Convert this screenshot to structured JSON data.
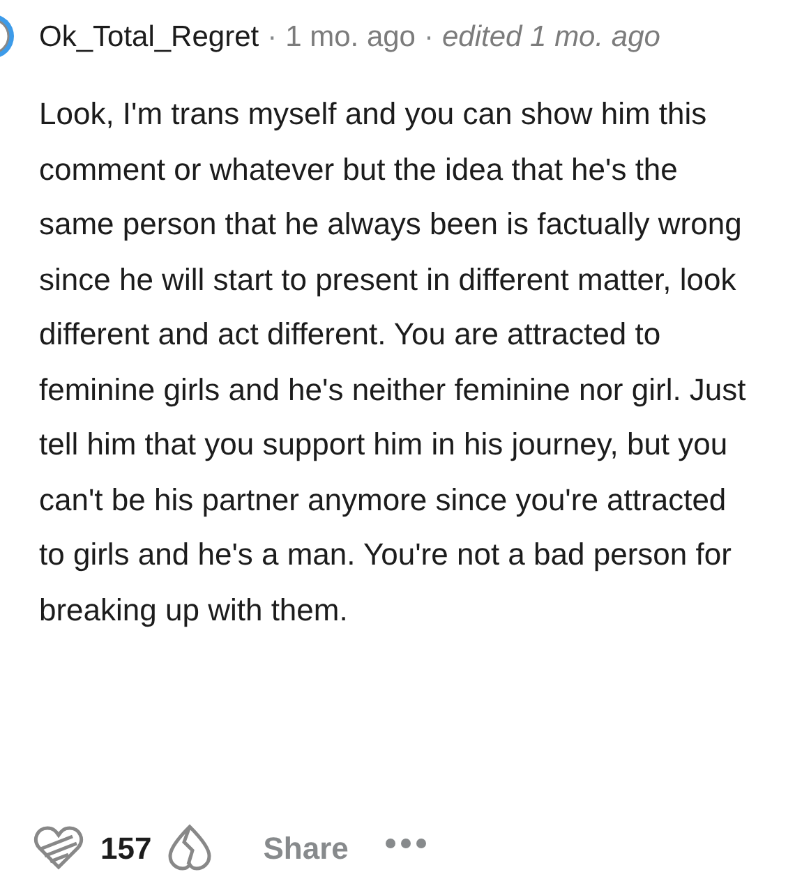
{
  "comment": {
    "author": "Ok_Total_Regret",
    "separator_1": "·",
    "time": "1 mo. ago",
    "separator_2": "·",
    "edited": "edited 1 mo. ago",
    "body": "Look, I'm trans myself and you can show him this comment or whatever but the idea that he's the same person that he always been is factually wrong since he will start to present in different matter, look different and act different. You are attracted to feminine girls and he's neither feminine nor girl. Just tell him that you support him in his journey, but you can't be his partner anymore since you're attracted to girls and he's a man. You're not a bad person for breaking up with them."
  },
  "actions": {
    "votes": "157",
    "share": "Share"
  }
}
